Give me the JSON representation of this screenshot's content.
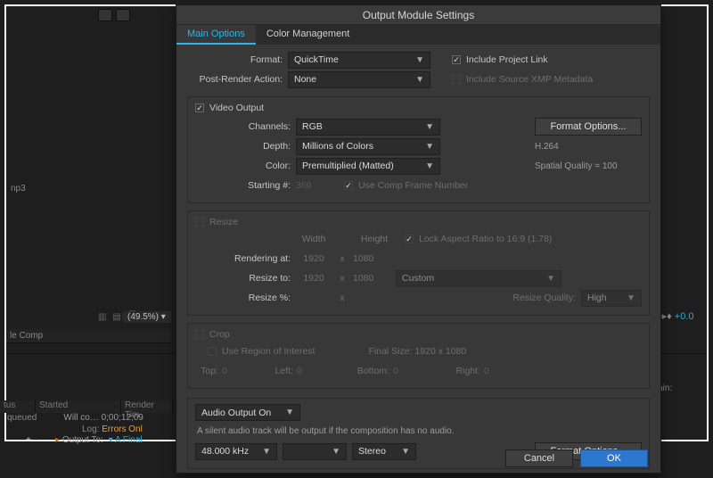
{
  "window_title": "Output Module Settings",
  "tabs": {
    "main": "Main Options",
    "color": "Color Management"
  },
  "format": {
    "label": "Format:",
    "value": "QuickTime"
  },
  "post_render": {
    "label": "Post-Render Action:",
    "value": "None"
  },
  "include_link": "Include Project Link",
  "include_xmp": "Include Source XMP Metadata",
  "video_output": {
    "title": "Video Output",
    "channels": {
      "label": "Channels:",
      "value": "RGB"
    },
    "depth": {
      "label": "Depth:",
      "value": "Millions of Colors"
    },
    "color": {
      "label": "Color:",
      "value": "Premultiplied (Matted)"
    },
    "start": {
      "label": "Starting #:",
      "value": "369"
    },
    "use_comp_frame": "Use Comp Frame Number",
    "format_options_btn": "Format Options...",
    "codec_line1": "H.264",
    "codec_line2": "Spatial Quality = 100"
  },
  "resize": {
    "title": "Resize",
    "width_hdr": "Width",
    "height_hdr": "Height",
    "lock_ar": "Lock Aspect Ratio to 16:9 (1.78)",
    "rendering_at": "Rendering at:",
    "rw": "1920",
    "rh": "1080",
    "resize_to": "Resize to:",
    "tw": "1920",
    "th": "1080",
    "custom": "Custom",
    "resize_pct": "Resize %:",
    "quality_lbl": "Resize Quality:",
    "quality": "High"
  },
  "crop": {
    "title": "Crop",
    "use_roi": "Use Region of Interest",
    "final_size": "Final Size: 1920 x 1080",
    "top": "Top:",
    "left": "Left:",
    "bottom": "Bottom:",
    "right": "Right:",
    "v": "0"
  },
  "audio": {
    "on": "Audio Output On",
    "note": "A silent audio track will be output if the composition has no audio.",
    "rate": "48.000 kHz",
    "bit": "",
    "channels": "Stereo",
    "format_options_btn": "Format Options..."
  },
  "buttons": {
    "ok": "OK",
    "cancel": "Cancel"
  },
  "bg": {
    "zoom": "(49.5%)",
    "plus0": "+0.0",
    "lecomp": "le Comp",
    "est_remain": "Est. Remain:",
    "hdr_tus": "tus",
    "hdr_started": "Started",
    "hdr_rt": "Render Tim",
    "queued": "queued",
    "willco": "Will co… 0;00;12;09",
    "log_lbl": "Log:",
    "log_val": "Errors Onl",
    "out_lbl": "Output To:",
    "out_val": "A Final",
    "pm": "+  –",
    "mp3": "np3"
  }
}
